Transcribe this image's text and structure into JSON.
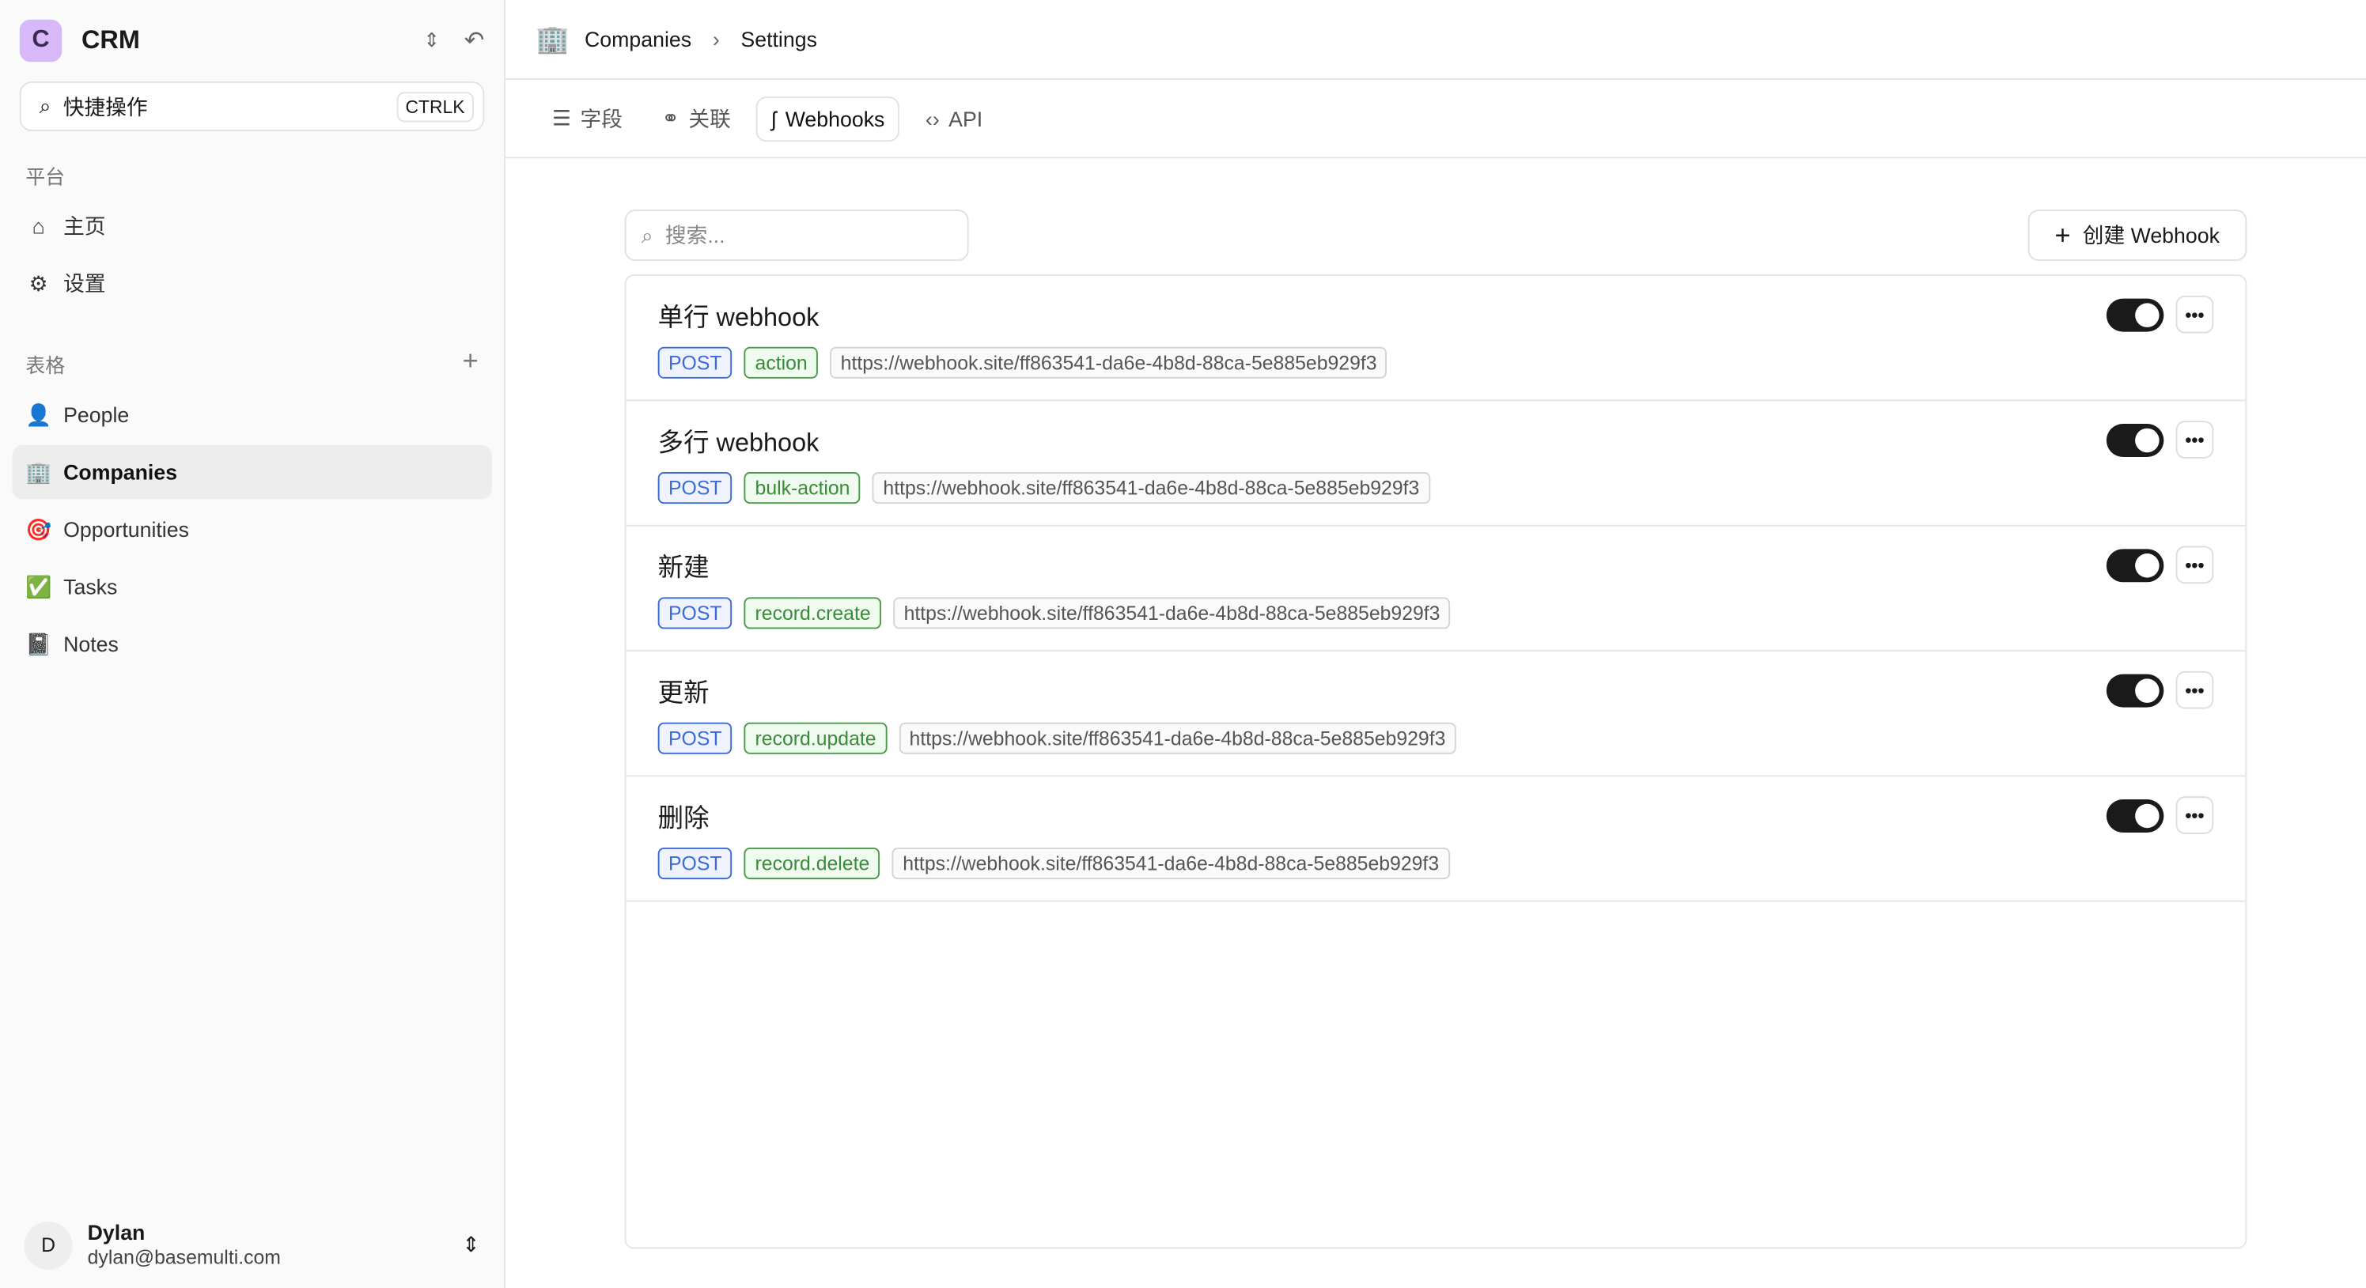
{
  "sidebar": {
    "logo": "C",
    "app": "CRM",
    "quick": "快捷操作",
    "shortcut": "CTRLK",
    "platform_label": "平台",
    "platform": [
      {
        "label": "主页",
        "icon": "⌂"
      },
      {
        "label": "设置",
        "icon": "⚙"
      }
    ],
    "tables_label": "表格",
    "add": "+",
    "tables": [
      {
        "label": "People",
        "icon": "👤"
      },
      {
        "label": "Companies",
        "icon": "🏢"
      },
      {
        "label": "Opportunities",
        "icon": "🎯"
      },
      {
        "label": "Tasks",
        "icon": "✅"
      },
      {
        "label": "Notes",
        "icon": "📓"
      }
    ],
    "user": {
      "initial": "D",
      "name": "Dylan",
      "email": "dylan@basemulti.com"
    }
  },
  "breadcrumb": {
    "icon": "🏢",
    "items": [
      "Companies",
      "Settings"
    ],
    "sep": "›"
  },
  "tabs": [
    {
      "label": "字段",
      "icon": "☰"
    },
    {
      "label": "关联",
      "icon": "⚭"
    },
    {
      "label": "Webhooks",
      "icon": "ʃ"
    },
    {
      "label": "API",
      "icon": "‹›"
    }
  ],
  "search": {
    "placeholder": "搜索..."
  },
  "create_label": "创建 Webhook",
  "webhooks": [
    {
      "name": "单行 webhook",
      "method": "POST",
      "event": "action",
      "url": "https://webhook.site/ff863541-da6e-4b8d-88ca-5e885eb929f3",
      "enabled": true
    },
    {
      "name": "多行 webhook",
      "method": "POST",
      "event": "bulk-action",
      "url": "https://webhook.site/ff863541-da6e-4b8d-88ca-5e885eb929f3",
      "enabled": true
    },
    {
      "name": "新建",
      "method": "POST",
      "event": "record.create",
      "url": "https://webhook.site/ff863541-da6e-4b8d-88ca-5e885eb929f3",
      "enabled": true
    },
    {
      "name": "更新",
      "method": "POST",
      "event": "record.update",
      "url": "https://webhook.site/ff863541-da6e-4b8d-88ca-5e885eb929f3",
      "enabled": true
    },
    {
      "name": "删除",
      "method": "POST",
      "event": "record.delete",
      "url": "https://webhook.site/ff863541-da6e-4b8d-88ca-5e885eb929f3",
      "enabled": true
    }
  ]
}
